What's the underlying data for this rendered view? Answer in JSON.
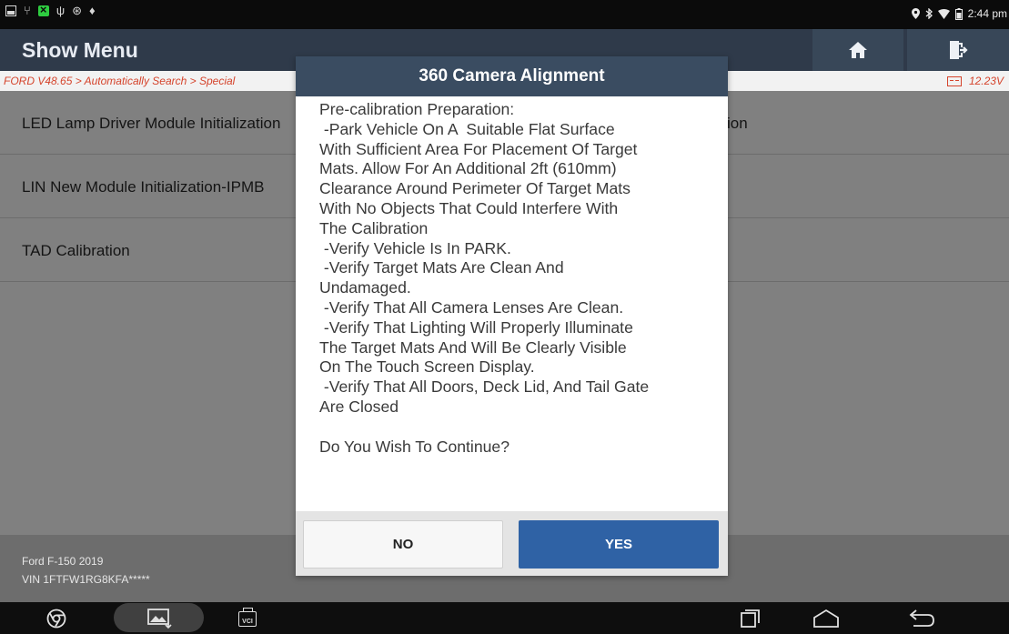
{
  "status_bar": {
    "time": "2:44 pm",
    "icons": [
      "image-notification-icon",
      "usb-icon",
      "green-app-icon",
      "usb-debug-icon",
      "accessibility-icon",
      "android-debug-icon",
      "location-icon",
      "bluetooth-icon",
      "wifi-icon",
      "battery-icon"
    ]
  },
  "header": {
    "title": "Show Menu",
    "home_icon": "home-icon",
    "exit_icon": "exit-icon",
    "bg_color": "#2f3a4a"
  },
  "breadcrumb": {
    "path": "FORD V48.65 > Automatically Search > Special",
    "voltage": "12.23V",
    "color": "#d5442c"
  },
  "menu": {
    "rows": [
      {
        "left": "LED Lamp Driver Module Initialization",
        "right": "ion"
      },
      {
        "left": "LIN New Module Initialization-IPMB",
        "right": ""
      },
      {
        "left": "TAD Calibration",
        "right": ""
      }
    ]
  },
  "vehicle": {
    "model": "Ford F-150 2019",
    "vin": "VIN 1FTFW1RG8KFA*****"
  },
  "dialog": {
    "title": "360 Camera Alignment",
    "lines": [
      "Pre-calibration Preparation:",
      " -Park Vehicle On A  Suitable Flat Surface",
      "With Sufficient Area For Placement Of Target",
      "Mats. Allow For An Additional 2ft (610mm)",
      "Clearance Around Perimeter Of Target Mats",
      "With No Objects That Could Interfere With",
      "The Calibration",
      " -Verify Vehicle Is In PARK.",
      " -Verify Target Mats Are Clean And",
      "Undamaged.",
      " -Verify That All Camera Lenses Are Clean.",
      " -Verify That Lighting Will Properly Illuminate",
      "The Target Mats And Will Be Clearly Visible",
      "On The Touch Screen Display.",
      " -Verify That All Doors, Deck Lid, And Tail Gate",
      "Are Closed"
    ],
    "question": "Do You Wish To Continue?",
    "no_label": "NO",
    "yes_label": "YES",
    "yes_color": "#2f62a5",
    "header_color": "#3a4c61"
  },
  "nav_bar": {
    "vci_label": "VCI",
    "icons": [
      "chrome-icon",
      "gallery-icon",
      "vci-icon",
      "recents-icon",
      "home-nav-icon",
      "back-icon"
    ]
  }
}
